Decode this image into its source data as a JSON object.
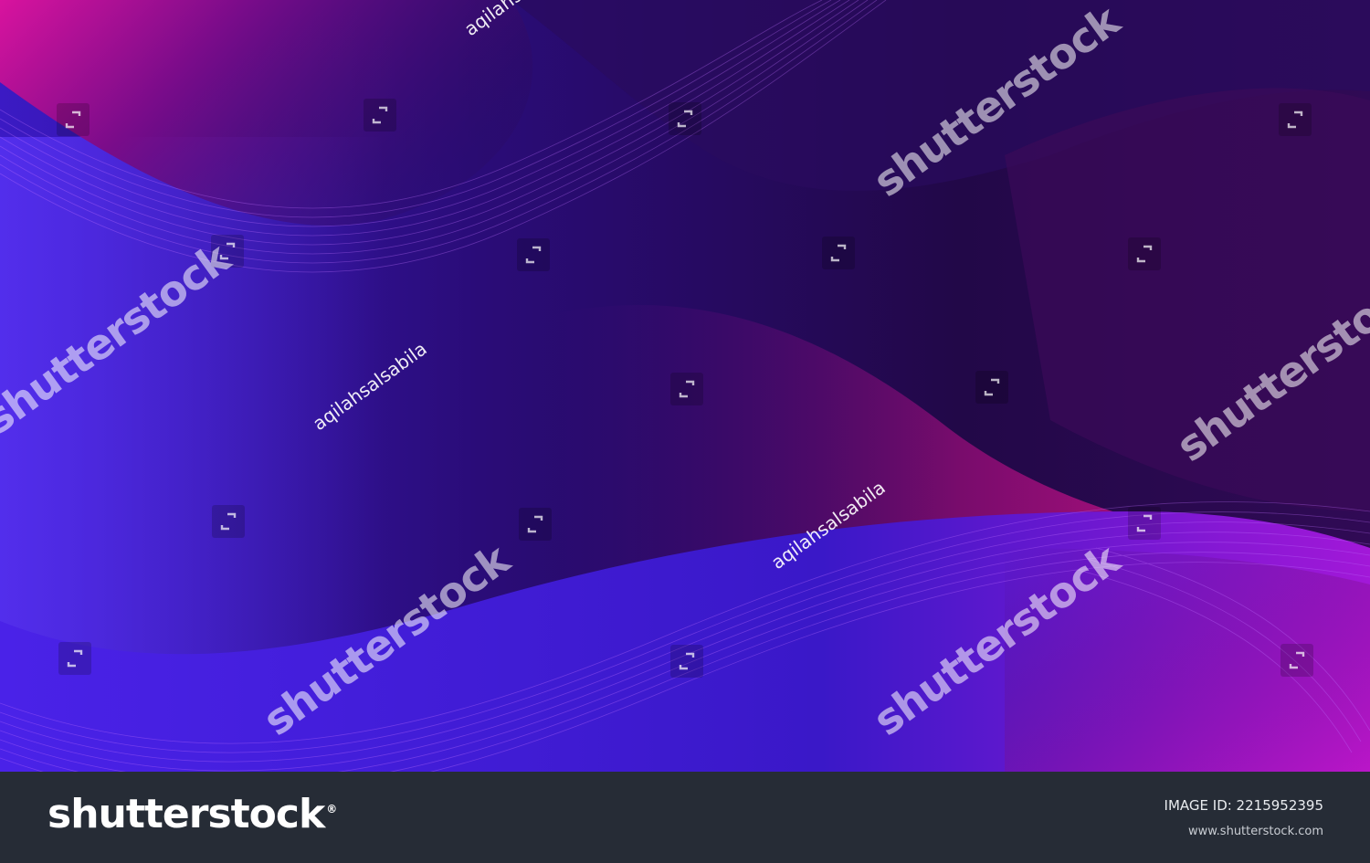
{
  "watermark": {
    "brand": "shutterstock",
    "contributor": "aqilahsalsabila",
    "icon": "shutterstock-frame-icon"
  },
  "footer": {
    "logo_text": "shutterstock",
    "image_id": "IMAGE ID: 2215952395",
    "url": "www.shutterstock.com"
  },
  "colors": {
    "deep_purple": "#240a4e",
    "violet": "#4a1fd8",
    "magenta": "#e0129a",
    "footer_bg": "#262c36"
  }
}
